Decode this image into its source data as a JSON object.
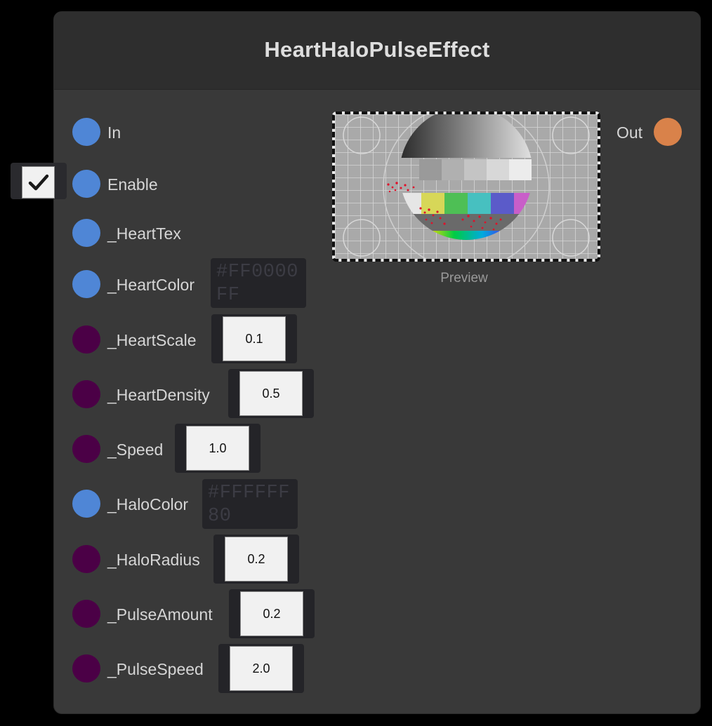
{
  "node": {
    "title": "HeartHaloPulseEffect"
  },
  "colors": {
    "port_blue": "#4f86d6",
    "port_purple": "#4b0046",
    "port_orange": "#d9824a",
    "node_bg": "#393939",
    "header_bg": "#2e2e2e"
  },
  "inputs": [
    {
      "label": "In",
      "port_type": "flow"
    },
    {
      "label": "Enable",
      "port_type": "bool",
      "checked": true
    },
    {
      "label": "_HeartTex",
      "port_type": "texture"
    },
    {
      "label": "_HeartColor",
      "port_type": "color",
      "value": "#FF0000FF"
    },
    {
      "label": "_HeartScale",
      "port_type": "float",
      "value": "0.1"
    },
    {
      "label": "_HeartDensity",
      "port_type": "float",
      "value": "0.5"
    },
    {
      "label": "_Speed",
      "port_type": "float",
      "value": "1.0"
    },
    {
      "label": "_HaloColor",
      "port_type": "color",
      "value": "#FFFFFF80"
    },
    {
      "label": "_HaloRadius",
      "port_type": "float",
      "value": "0.2"
    },
    {
      "label": "_PulseAmount",
      "port_type": "float",
      "value": "0.2"
    },
    {
      "label": "_PulseSpeed",
      "port_type": "float",
      "value": "2.0"
    }
  ],
  "output": {
    "label": "Out"
  },
  "preview": {
    "caption": "Preview"
  },
  "icons": {
    "checkbox": "checkmark-icon"
  }
}
